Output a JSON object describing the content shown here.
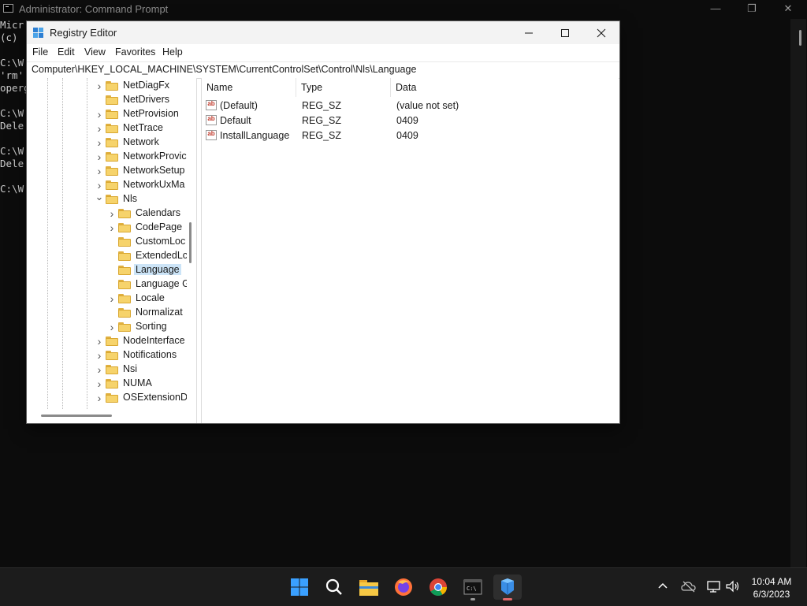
{
  "cmd": {
    "title": "Administrator: Command Prompt",
    "lines": [
      "Micr",
      "(c) ",
      "",
      "C:\\W",
      "'rm'",
      "operg",
      "",
      "C:\\W",
      "Dele",
      "",
      "C:\\W",
      "Dele",
      "",
      "C:\\W"
    ],
    "buttons": {
      "minimize": "—",
      "restore": "❐",
      "close": "✕"
    }
  },
  "regedit": {
    "title": "Registry Editor",
    "menu": [
      "File",
      "Edit",
      "View",
      "Favorites",
      "Help"
    ],
    "address": "Computer\\HKEY_LOCAL_MACHINE\\SYSTEM\\CurrentControlSet\\Control\\Nls\\Language",
    "tree": [
      {
        "label": "NetDiagFx",
        "expandable": true
      },
      {
        "label": "NetDrivers",
        "expandable": false
      },
      {
        "label": "NetProvision",
        "expandable": true
      },
      {
        "label": "NetTrace",
        "expandable": true
      },
      {
        "label": "Network",
        "expandable": true
      },
      {
        "label": "NetworkProvic",
        "expandable": true
      },
      {
        "label": "NetworkSetup",
        "expandable": true
      },
      {
        "label": "NetworkUxMa",
        "expandable": true
      },
      {
        "label": "Nls",
        "expanded": true
      },
      {
        "label": "Calendars",
        "expandable": true,
        "child": true
      },
      {
        "label": "CodePage",
        "expandable": true,
        "child": true
      },
      {
        "label": "CustomLoc",
        "expandable": false,
        "child": true
      },
      {
        "label": "ExtendedLc",
        "expandable": false,
        "child": true
      },
      {
        "label": "Language",
        "expandable": false,
        "child": true,
        "selected": true
      },
      {
        "label": "Language G",
        "expandable": false,
        "child": true
      },
      {
        "label": "Locale",
        "expandable": true,
        "child": true
      },
      {
        "label": "Normalizat",
        "expandable": false,
        "child": true
      },
      {
        "label": "Sorting",
        "expandable": true,
        "child": true
      },
      {
        "label": "NodeInterface",
        "expandable": true
      },
      {
        "label": "Notifications",
        "expandable": true
      },
      {
        "label": "Nsi",
        "expandable": true
      },
      {
        "label": "NUMA",
        "expandable": true
      },
      {
        "label": "OSExtensionD",
        "expandable": true
      }
    ],
    "columns": {
      "name": "Name",
      "type": "Type",
      "data": "Data"
    },
    "values": [
      {
        "name": "(Default)",
        "type": "REG_SZ",
        "data": "(value not set)"
      },
      {
        "name": "Default",
        "type": "REG_SZ",
        "data": "0409"
      },
      {
        "name": "InstallLanguage",
        "type": "REG_SZ",
        "data": "0409"
      }
    ]
  },
  "taskbar": {
    "apps": [
      "start-icon",
      "search-icon",
      "file-explorer-icon",
      "firefox-icon",
      "chrome-icon",
      "terminal-icon",
      "regedit-icon"
    ],
    "time": "10:04 AM",
    "date": "6/3/2023"
  }
}
